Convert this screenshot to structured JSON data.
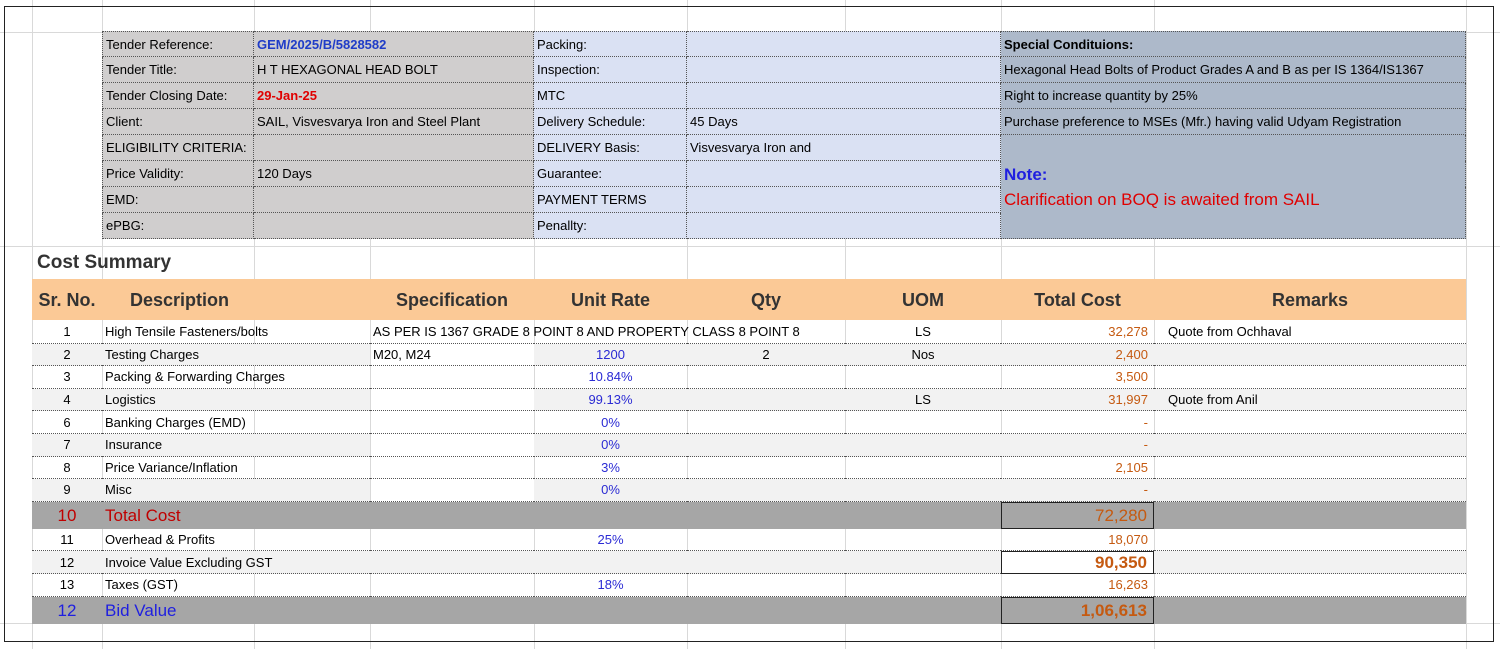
{
  "tender_info": {
    "left": [
      {
        "label": "Tender Reference:",
        "value": "GEM/2025/B/5828582",
        "style": "navy"
      },
      {
        "label": "Tender Title:",
        "value": "H T HEXAGONAL HEAD BOLT",
        "style": "plain"
      },
      {
        "label": "Tender Closing Date:",
        "value": "29-Jan-25",
        "style": "red"
      },
      {
        "label": "Client:",
        "value": "SAIL, Visvesvarya Iron and Steel Plant",
        "style": "plain"
      },
      {
        "label": "ELIGIBILITY CRITERIA:",
        "value": "",
        "style": "plain"
      },
      {
        "label": "Price Validity:",
        "value": "120 Days",
        "style": "plain"
      },
      {
        "label": "EMD:",
        "value": "",
        "style": "plain"
      },
      {
        "label": "ePBG:",
        "value": "",
        "style": "plain"
      }
    ],
    "middle": [
      {
        "label": "Packing:",
        "value": ""
      },
      {
        "label": "Inspection:",
        "value": ""
      },
      {
        "label": "MTC",
        "value": ""
      },
      {
        "label": "Delivery Schedule:",
        "value": "45 Days"
      },
      {
        "label": "DELIVERY Basis:",
        "value": "Visvesvarya Iron and"
      },
      {
        "label": "Guarantee:",
        "value": ""
      },
      {
        "label": "PAYMENT TERMS",
        "value": ""
      },
      {
        "label": "Penallty:",
        "value": ""
      }
    ],
    "special_conditions": {
      "heading": "Special Condituions:",
      "items": [
        "Hexagonal Head Bolts of Product Grades A and B as per IS 1364/IS1367",
        "Right to increase quantity by 25%",
        "Purchase preference to MSEs (Mfr.) having valid Udyam Registration"
      ],
      "note_label": "Note:",
      "note_text": "Clarification on BOQ is awaited from SAIL"
    }
  },
  "cost_summary": {
    "title": "Cost Summary",
    "headers": [
      "Sr. No.",
      "Description",
      "Specification",
      "Unit Rate",
      "Qty",
      "UOM",
      "Total Cost",
      "Remarks"
    ],
    "rows": [
      {
        "sr": "1",
        "desc": "High Tensile Fasteners/bolts",
        "spec": "AS PER IS 1367 GRADE 8 POINT 8 AND PROPERTY CLASS 8 POINT 8",
        "rate": "",
        "qty": "",
        "uom": "LS",
        "total": "32,278",
        "remarks": "Quote from Ochhaval"
      },
      {
        "sr": "2",
        "desc": "Testing Charges",
        "spec": "M20, M24",
        "rate": "1200",
        "qty": "2",
        "uom": "Nos",
        "total": "2,400",
        "remarks": ""
      },
      {
        "sr": "3",
        "desc": "Packing & Forwarding Charges",
        "spec": "",
        "rate": "10.84%",
        "qty": "",
        "uom": "",
        "total": "3,500",
        "remarks": ""
      },
      {
        "sr": "4",
        "desc": "Logistics",
        "spec": "",
        "rate": "99.13%",
        "qty": "",
        "uom": "LS",
        "total": "31,997",
        "remarks": "Quote from Anil"
      },
      {
        "sr": "6",
        "desc": "Banking Charges (EMD)",
        "spec": "",
        "rate": "0%",
        "qty": "",
        "uom": "",
        "total": "-",
        "remarks": ""
      },
      {
        "sr": "7",
        "desc": "Insurance",
        "spec": "",
        "rate": "0%",
        "qty": "",
        "uom": "",
        "total": "-",
        "remarks": ""
      },
      {
        "sr": "8",
        "desc": "Price Variance/Inflation",
        "spec": "",
        "rate": "3%",
        "qty": "",
        "uom": "",
        "total": "2,105",
        "remarks": ""
      },
      {
        "sr": "9",
        "desc": "Misc",
        "spec": "",
        "rate": "0%",
        "qty": "",
        "uom": "",
        "total": "-",
        "remarks": ""
      }
    ],
    "total_row": {
      "sr": "10",
      "desc": "Total Cost",
      "total": "72,280"
    },
    "post_rows": [
      {
        "sr": "11",
        "desc": "Overhead & Profits",
        "rate": "25%",
        "total": "18,070"
      },
      {
        "sr": "12",
        "desc": "Invoice Value Excluding GST",
        "rate": "",
        "total": "90,350"
      },
      {
        "sr": "13",
        "desc": "Taxes (GST)",
        "rate": "18%",
        "total": "16,263"
      }
    ],
    "bid_row": {
      "sr": "12",
      "desc": "Bid Value",
      "total": "1,06,613"
    }
  }
}
